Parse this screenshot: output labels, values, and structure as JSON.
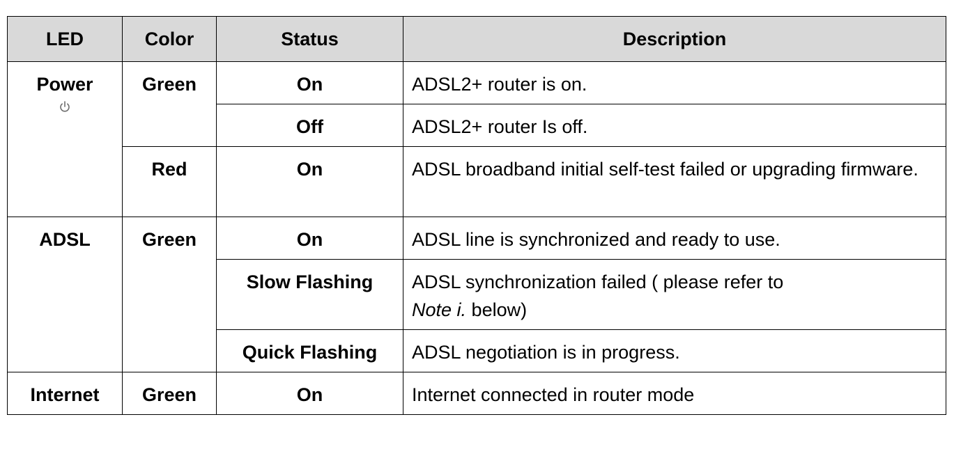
{
  "headers": {
    "led": "LED",
    "color": "Color",
    "status": "Status",
    "description": "Description"
  },
  "rows": {
    "power": {
      "led": "Power",
      "icon": "power-icon",
      "green": {
        "color": "Green",
        "on": {
          "status": "On",
          "desc": "ADSL2+ router is on."
        },
        "off": {
          "status": "Off",
          "desc": "ADSL2+ router Is off."
        }
      },
      "red": {
        "color": "Red",
        "on": {
          "status": "On",
          "desc": "ADSL broadband initial self-test failed or upgrading firmware."
        }
      }
    },
    "adsl": {
      "led": "ADSL",
      "color": "Green",
      "on": {
        "status": "On",
        "desc": "ADSL line is synchronized and ready to use."
      },
      "slow": {
        "status": "Slow Flashing",
        "desc_prefix": "ADSL synchronization failed ( please refer to",
        "desc_note": "Note i.",
        "desc_suffix": " below)"
      },
      "quick": {
        "status": "Quick Flashing",
        "desc": "ADSL negotiation is in progress."
      }
    },
    "internet": {
      "led": "Internet",
      "color": "Green",
      "on": {
        "status": "On",
        "desc": "Internet connected in router mode"
      }
    }
  }
}
